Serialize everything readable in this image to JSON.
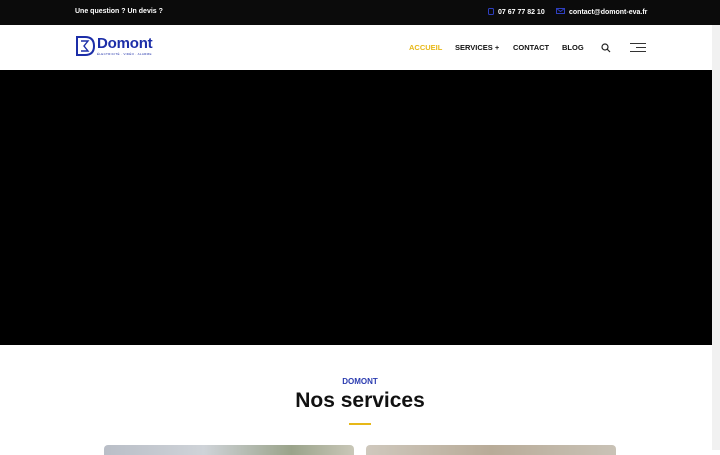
{
  "topbar": {
    "question": "Une question ? Un devis ?",
    "phone": "07 67 77 82 10",
    "email": "contact@domont-eva.fr"
  },
  "logo": {
    "word": "Domont",
    "tagline": "ÉLECTRICITÉ · VIDÉO · ALARME"
  },
  "nav": {
    "home": "ACCUEIL",
    "services": "SERVICES +",
    "contact": "CONTACT",
    "blog": "BLOG"
  },
  "colors": {
    "accent": "#e7b818",
    "brand": "#1c2ea8"
  },
  "section": {
    "kicker": "DOMONT",
    "title": "Nos services"
  }
}
